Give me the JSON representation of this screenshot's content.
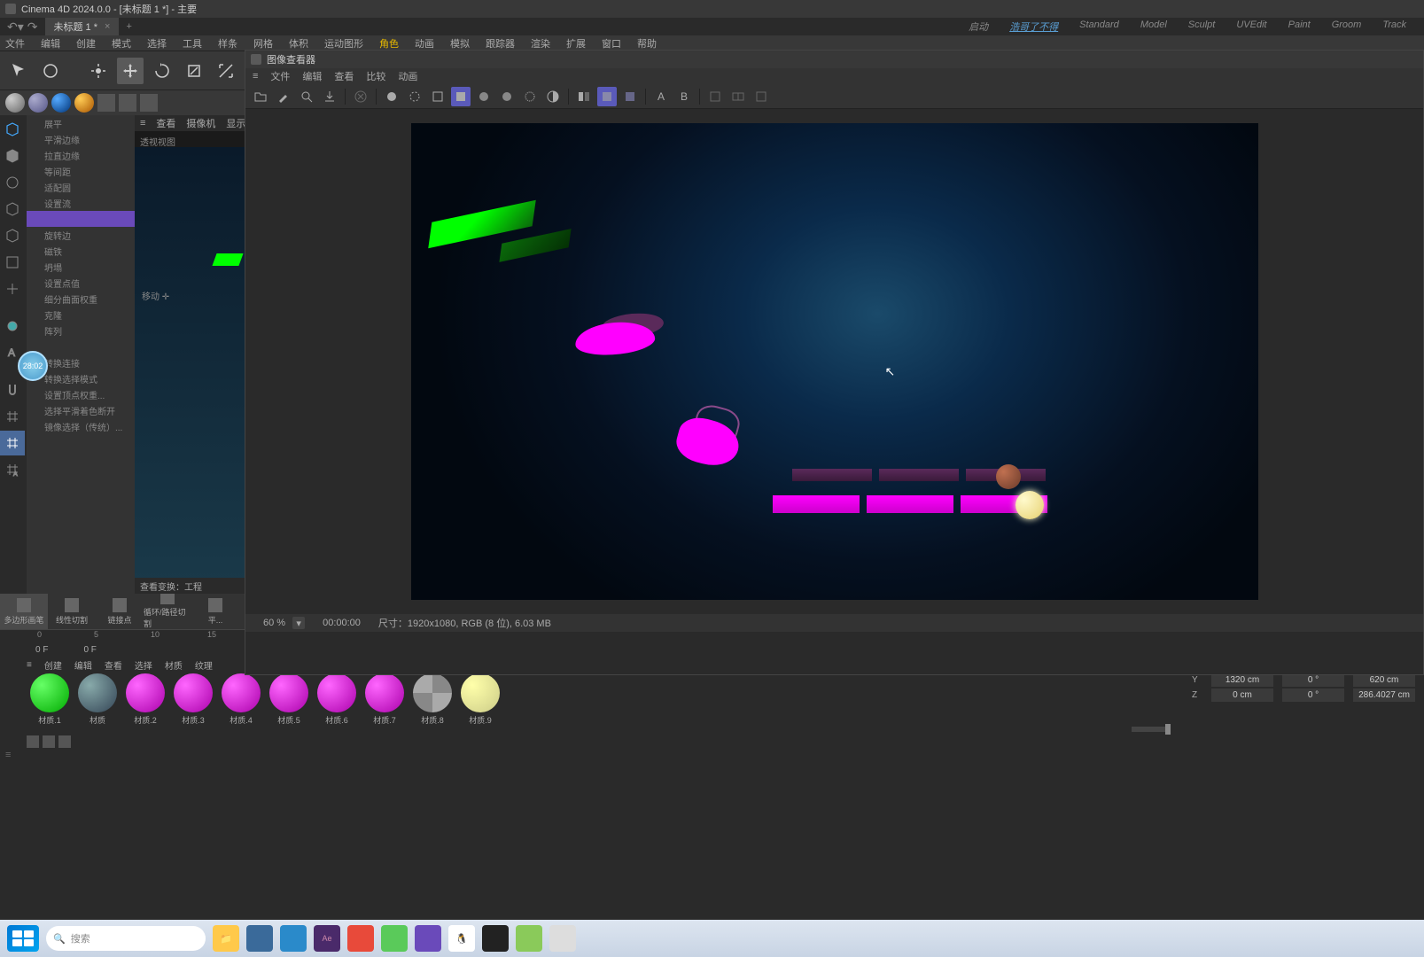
{
  "app": {
    "title": "Cinema 4D 2024.0.0 - [未标题 1 *] - 主要",
    "tab_name": "未标题 1 *"
  },
  "layouts": [
    "启动",
    "浩哥了不得",
    "Standard",
    "Model",
    "Sculpt",
    "UVEdit",
    "Paint",
    "Groom",
    "Track"
  ],
  "layout_active_index": 1,
  "main_menu": [
    "文件",
    "编辑",
    "创建",
    "模式",
    "选择",
    "工具",
    "样条",
    "网格",
    "体积",
    "运动图形",
    "角色",
    "动画",
    "模拟",
    "跟踪器",
    "渲染",
    "扩展",
    "窗口",
    "帮助"
  ],
  "highlight_index": 10,
  "side_items": [
    "展平",
    "平滑边缘",
    "拉直边缘",
    "等间距",
    "适配圆",
    "设置流",
    "",
    "旋转边",
    "磁铁",
    "坍塌",
    "设置点值",
    "细分曲面权重",
    "克隆",
    "阵列",
    "",
    "转换连接",
    "转换选择模式",
    "设置顶点权重...",
    "选择平滑着色断开",
    "镜像选择（传统）..."
  ],
  "side_selected_index": 6,
  "viewport": {
    "menu": [
      "查看",
      "摄像机",
      "显示"
    ],
    "label": "透视视图",
    "move_label": "移动",
    "footer": "查看变换：工程"
  },
  "picture_viewer": {
    "title": "图像查看器",
    "menu": [
      "文件",
      "编辑",
      "查看",
      "比较",
      "动画"
    ],
    "zoom": "60 %",
    "time": "00:00:00",
    "info": "尺寸：1920x1080, RGB (8 位), 6.03 MB",
    "ab_a": "A",
    "ab_b": "B"
  },
  "timer": "28:02",
  "palette": [
    "多边形画笔",
    "线性切割",
    "链接点",
    "循环/路径切割",
    "平..."
  ],
  "ruler_ticks": [
    {
      "pos": 42,
      "label": "0"
    },
    {
      "pos": 106,
      "label": "5"
    },
    {
      "pos": 170,
      "label": "10"
    },
    {
      "pos": 234,
      "label": "15"
    }
  ],
  "frames": {
    "current": "0 F",
    "end": "0 F"
  },
  "mat_menu": [
    "创建",
    "编辑",
    "查看",
    "选择",
    "材质",
    "纹理"
  ],
  "materials": [
    {
      "name": "材质.1",
      "color": "radial-gradient(circle at 30% 30%, #6f6, #0a0)"
    },
    {
      "name": "材质",
      "color": "radial-gradient(circle at 30% 30%, #8aa, #345)"
    },
    {
      "name": "材质.2",
      "color": "radial-gradient(circle at 30% 30%, #f6f, #a0a)"
    },
    {
      "name": "材质.3",
      "color": "radial-gradient(circle at 30% 30%, #f6f, #a0a)"
    },
    {
      "name": "材质.4",
      "color": "radial-gradient(circle at 30% 30%, #f6f, #a0a)"
    },
    {
      "name": "材质.5",
      "color": "radial-gradient(circle at 30% 30%, #f6f, #a0a)"
    },
    {
      "name": "材质.6",
      "color": "radial-gradient(circle at 30% 30%, #f6f, #a0a)"
    },
    {
      "name": "材质.7",
      "color": "radial-gradient(circle at 30% 30%, #f6f, #a0a)"
    },
    {
      "name": "材质.8",
      "color": "repeating-conic-gradient(#888 0% 25%, #aaa 0% 50%)"
    },
    {
      "name": "材质.9",
      "color": "radial-gradient(circle at 30% 30%, #ffa, #cc8)"
    }
  ],
  "coords": {
    "y": {
      "label": "Y",
      "pos": "1320 cm",
      "rot": "0 °",
      "scale": "620 cm"
    },
    "z": {
      "label": "Z",
      "pos": "0 cm",
      "rot": "0 °",
      "scale": "286.4027 cm"
    }
  },
  "taskbar": {
    "search_placeholder": "搜索"
  }
}
